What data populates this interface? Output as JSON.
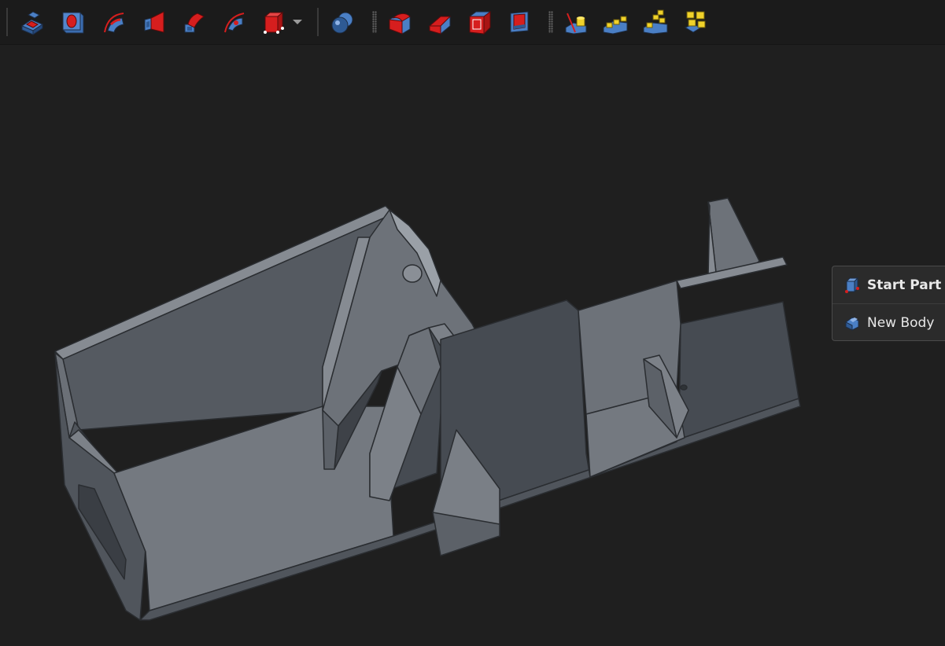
{
  "toolbar": {
    "groups": [
      {
        "icons": [
          "pad-icon",
          "pocket-icon",
          "revolution-icon",
          "additive-loft-icon",
          "additive-pipe-icon",
          "groove-icon",
          "additive-box-icon"
        ]
      },
      {
        "icons": [
          "boolean-icon"
        ]
      },
      {
        "icons": [
          "fillet-icon",
          "chamfer-icon",
          "draft-icon",
          "thickness-icon"
        ]
      },
      {
        "icons": [
          "mirrored-icon",
          "linear-pattern-icon",
          "polar-pattern-icon",
          "multitransform-icon"
        ]
      }
    ]
  },
  "context_menu": {
    "items": [
      {
        "label": "Start Part",
        "icon": "part-icon"
      },
      {
        "label": "New Body",
        "icon": "body-icon"
      }
    ]
  },
  "colors": {
    "background": "#1f1f1f",
    "model_face_light": "#6d7279",
    "model_face_dark": "#464b52",
    "toolbar_icon_red": "#d61e1e",
    "toolbar_icon_blue": "#3a6fb6"
  }
}
